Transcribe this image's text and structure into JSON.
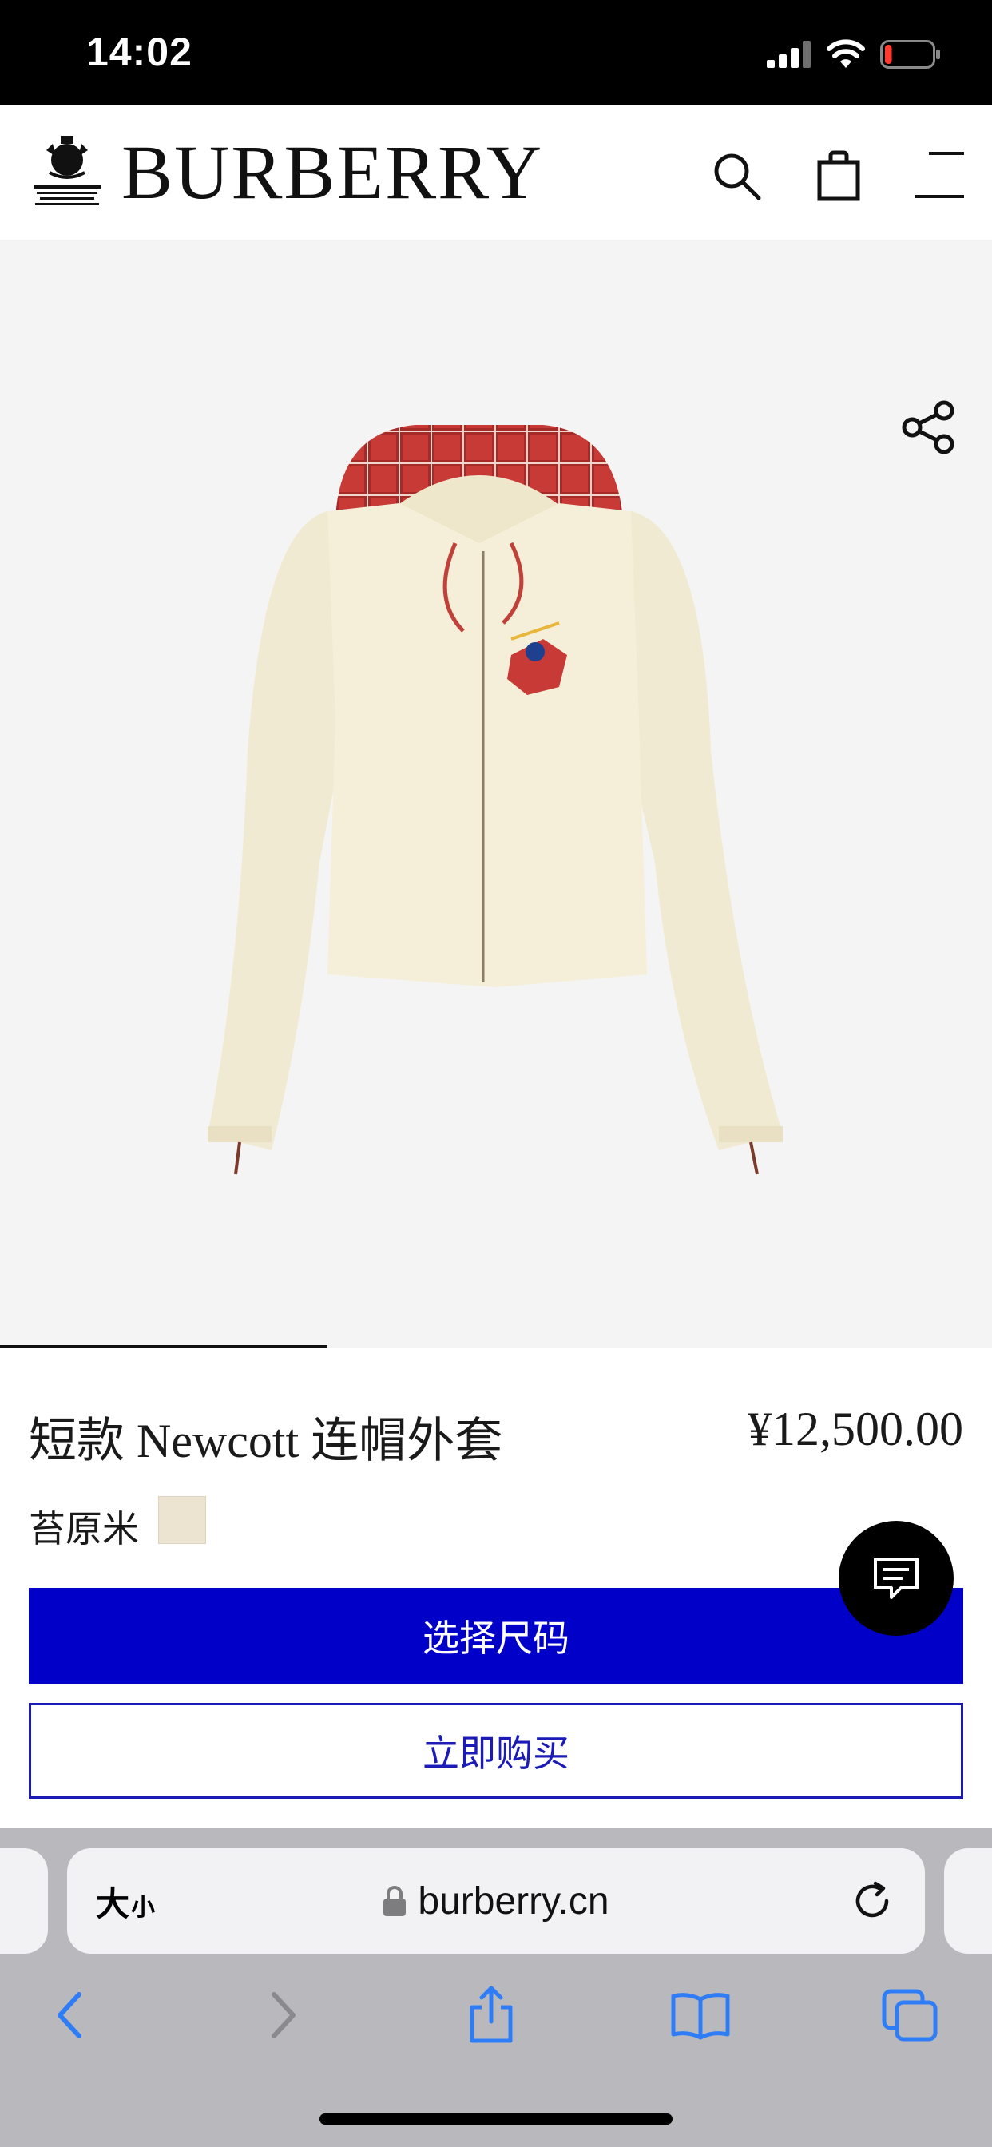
{
  "status_bar": {
    "time": "14:02",
    "battery_level": 0.15
  },
  "header": {
    "brand": "BURBERRY",
    "crest_icon": "royal-warrant-crest-icon",
    "icons": [
      "search-icon",
      "shopping-bag-icon",
      "menu-icon"
    ]
  },
  "hero": {
    "share_icon": "share-icon",
    "carousel_progress": 0.33
  },
  "product": {
    "name": "短款 Newcott 连帽外套",
    "price": "¥12,500.00",
    "color_name": "苔原米",
    "swatch_color": "#ece3d1"
  },
  "buttons": {
    "select_size": "选择尺码",
    "buy_now": "立即购买"
  },
  "chat": {
    "icon": "chat-icon"
  },
  "safari": {
    "text_size_big": "大",
    "text_size_small": "小",
    "url": "burberry.cn",
    "icons": [
      "back-icon",
      "forward-icon",
      "share-icon",
      "bookmarks-icon",
      "tabs-icon"
    ]
  },
  "colors": {
    "primary_button": "#0000c8",
    "outline_button": "#1b1bb8",
    "hero_bg": "#f4f4f4",
    "ios_blue": "#2f7df6"
  }
}
